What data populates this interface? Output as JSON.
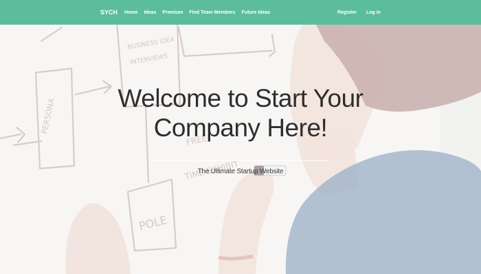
{
  "nav": {
    "brand": "SYCH",
    "links": [
      "Home",
      "Ideas",
      "Premium",
      "Find Team Members",
      "Future Ideas"
    ],
    "right_links": [
      "Register",
      "Log in"
    ]
  },
  "hero": {
    "title": "Welcome to Start Your Company Here!",
    "subtitle": "The Ultimate Startup Website",
    "background_image": "person-drawing-flowchart-on-whiteboard",
    "whiteboard_text": [
      "PERSONA",
      "BUSINESS IDEA",
      "INTERVIEWS",
      "FREE",
      "TIME EXHIBIT",
      "POLE"
    ]
  },
  "colors": {
    "navbar": "#5bbd9c",
    "nav_text": "#ffffff",
    "title_text": "#2e2e2e",
    "shirt": "#5a7aa0"
  }
}
